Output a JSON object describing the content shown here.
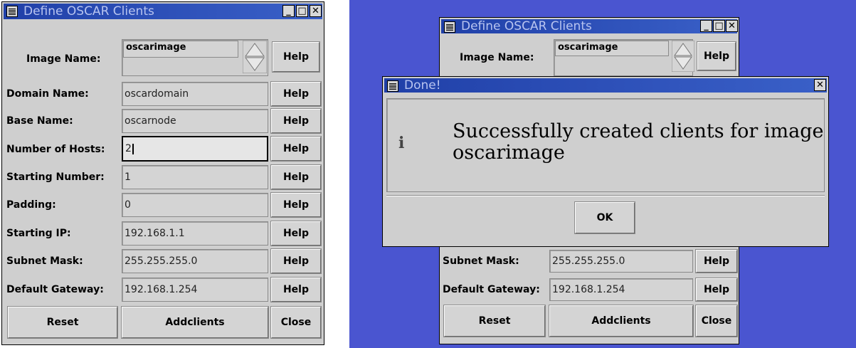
{
  "left_window": {
    "title": "Define OSCAR Clients",
    "image_name_label": "Image Name:",
    "image_name_value": "oscarimage",
    "help": "Help",
    "rows": [
      {
        "label": "Domain Name:",
        "value": "oscardomain"
      },
      {
        "label": "Base Name:",
        "value": "oscarnode"
      },
      {
        "label": "Number of Hosts:",
        "value": "2"
      },
      {
        "label": "Starting Number:",
        "value": "1"
      },
      {
        "label": "Padding:",
        "value": "0"
      },
      {
        "label": "Starting IP:",
        "value": "192.168.1.1"
      },
      {
        "label": "Subnet Mask:",
        "value": "255.255.255.0"
      },
      {
        "label": "Default Gateway:",
        "value": "192.168.1.254"
      }
    ],
    "reset": "Reset",
    "addclients": "Addclients",
    "close": "Close"
  },
  "right_window": {
    "title": "Define OSCAR Clients",
    "image_name_label": "Image Name:",
    "image_name_value": "oscarimage",
    "help": "Help",
    "rows": [
      {
        "label": "Subnet Mask:",
        "value": "255.255.255.0"
      },
      {
        "label": "Default Gateway:",
        "value": "192.168.1.254"
      }
    ],
    "reset": "Reset",
    "addclients": "Addclients",
    "close": "Close"
  },
  "dialog": {
    "title": "Done!",
    "message_line1": "Successfully created clients for image",
    "message_line2": "oscarimage",
    "info_glyph": "i",
    "ok": "OK"
  },
  "window_buttons": {
    "minimize": "_",
    "maximize": "□",
    "close": "✕"
  },
  "colors": {
    "desktop": "#4a55d0",
    "titlebar": "#2040a8",
    "window_bg": "#cfcfcf"
  }
}
